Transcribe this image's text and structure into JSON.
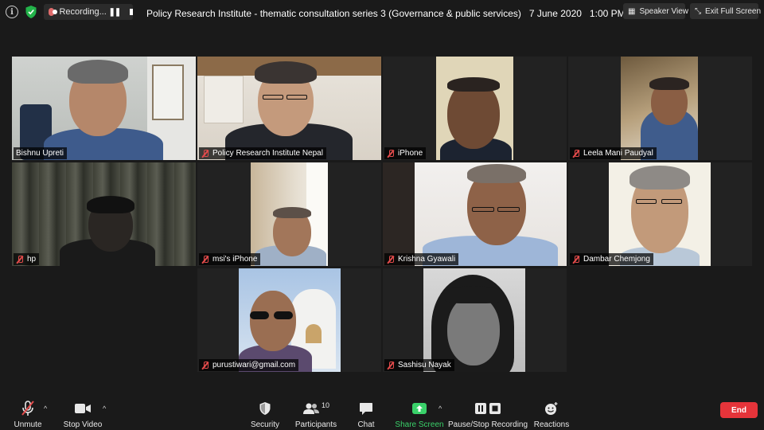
{
  "topbar": {
    "recording_label": "Recording...",
    "meeting_title": "Policy Research Institute - thematic consultation series 3 (Governance & public services)   7 June 2020   1:00 PM",
    "speaker_view": "Speaker View",
    "exit_full_screen": "Exit Full Screen"
  },
  "participants": [
    {
      "name": "Bishnu Upreti",
      "muted": false,
      "active": true
    },
    {
      "name": "Policy Research Institute Nepal",
      "muted": true
    },
    {
      "name": "iPhone",
      "muted": true
    },
    {
      "name": "Leela Mani Paudyal",
      "muted": true
    },
    {
      "name": "hp",
      "muted": true
    },
    {
      "name": "msi's iPhone",
      "muted": true
    },
    {
      "name": "Krishna Gyawali",
      "muted": true
    },
    {
      "name": "Dambar Chemjong",
      "muted": true
    },
    {
      "name": "purustiwari@gmail.com",
      "muted": true
    },
    {
      "name": "Sashisu Nayak",
      "muted": true
    }
  ],
  "toolbar": {
    "unmute": "Unmute",
    "stop_video": "Stop Video",
    "security": "Security",
    "participants": "Participants",
    "participants_count": "10",
    "chat": "Chat",
    "share_screen": "Share Screen",
    "pause_stop_recording": "Pause/Stop Recording",
    "reactions": "Reactions",
    "end": "End"
  },
  "colors": {
    "active_speaker_border": "#f1f08c",
    "share_screen_green": "#3ad16a",
    "end_red": "#e5343a",
    "muted_red": "#e34b4b"
  }
}
